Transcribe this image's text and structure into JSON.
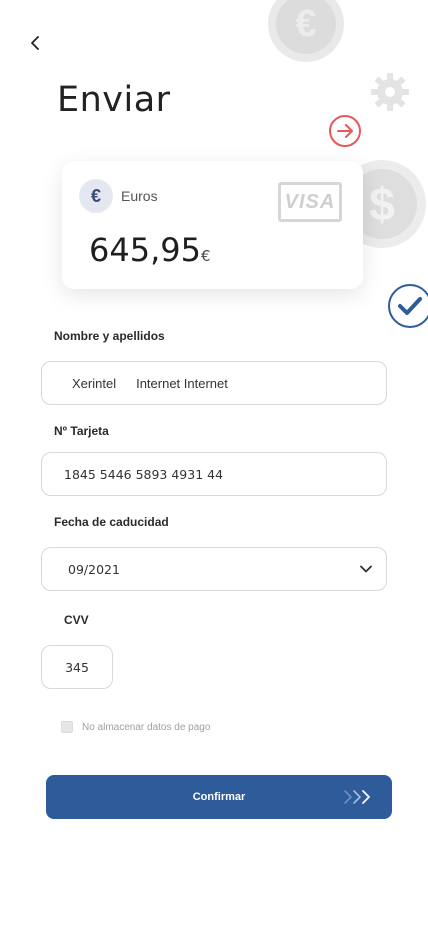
{
  "header": {
    "title": "Enviar"
  },
  "card": {
    "currency_symbol": "€",
    "currency_label": "Euros",
    "brand": "VISA",
    "amount": "645,95",
    "amount_currency": "€"
  },
  "form": {
    "name_label": "Nombre y apellidos",
    "first_name": "Xerintel",
    "last_name": "Internet Internet",
    "card_label": "Nº Tarjeta",
    "card_number": "1845 5446 5893 4931 44",
    "expiry_label": "Fecha de caducidad",
    "expiry_value": "09/2021",
    "cvv_label": "CVV",
    "cvv_value": "345",
    "save_checkbox_label": "No almacenar datos de pago",
    "save_checkbox_checked": false
  },
  "actions": {
    "confirm_label": "Confirmar"
  },
  "decor": {
    "coin_top_symbol": "€",
    "coin_right_symbol": "$"
  },
  "colors": {
    "primary": "#2e5b9a",
    "arrow_accent": "#e8585a",
    "check_accent": "#2e5b9a"
  }
}
